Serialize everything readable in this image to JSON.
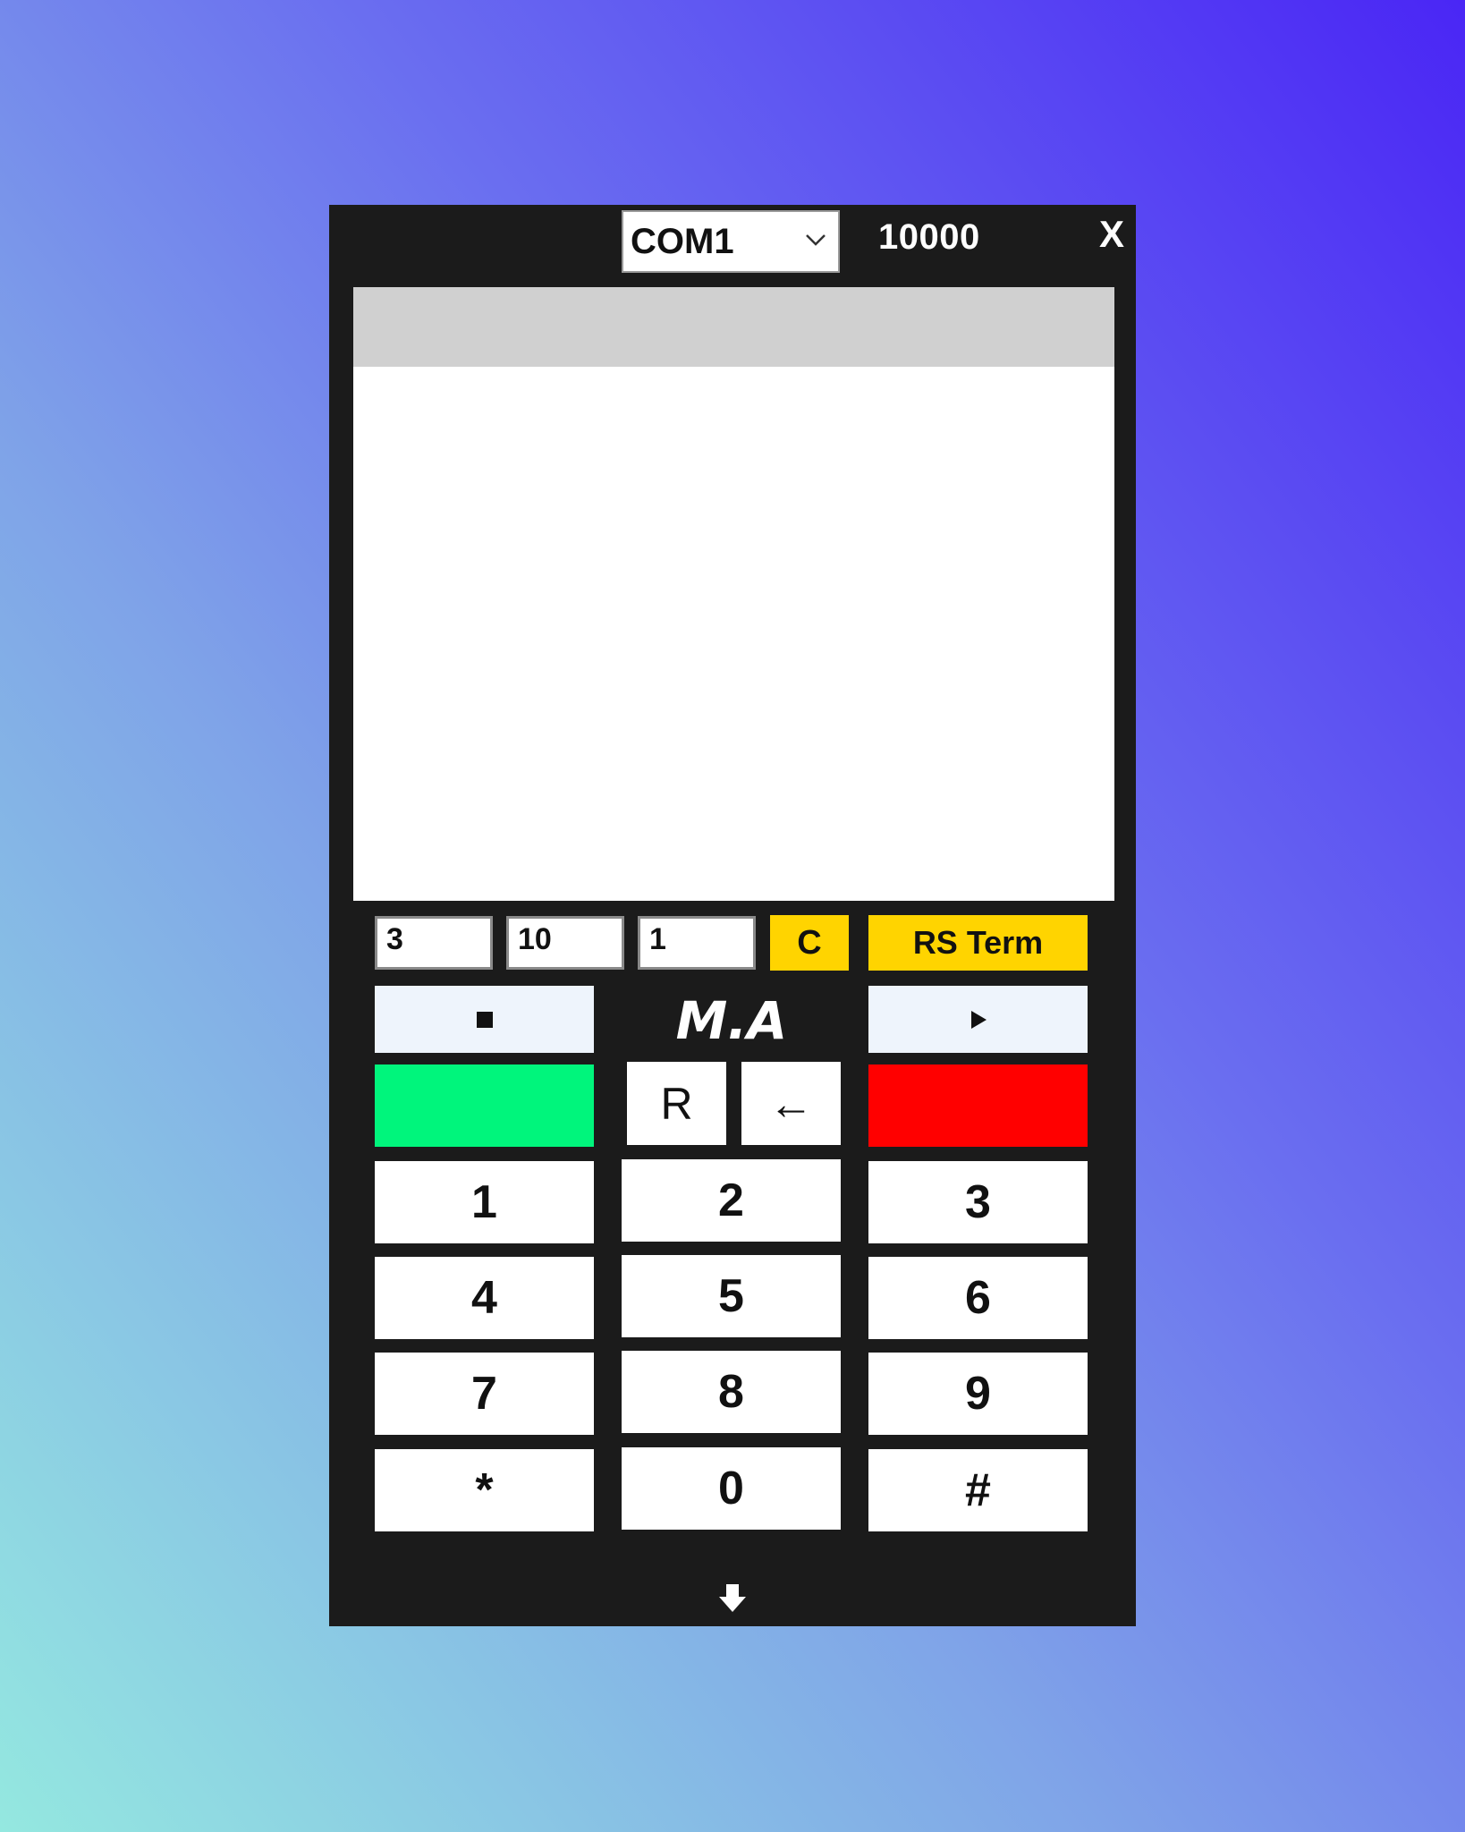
{
  "window": {
    "port": {
      "selected": "COM1",
      "icon": "chevron-down-icon"
    },
    "baud_label": "10000",
    "close_label": "X"
  },
  "controls": {
    "input_1": "3",
    "input_2": "10",
    "input_3": "1",
    "clear_label": "C",
    "rs_term_label": "RS Term",
    "stop_icon": "square-stop-icon",
    "play_icon": "play-triangle-icon",
    "logo_text": "M.A",
    "green_color": "#00f57c",
    "red_color": "#ff0000",
    "r_label": "R",
    "back_label": "←"
  },
  "keypad": {
    "k1": "1",
    "k2": "2",
    "k3": "3",
    "k4": "4",
    "k5": "5",
    "k6": "6",
    "k7": "7",
    "k8": "8",
    "k9": "9",
    "kstar": "*",
    "k0": "0",
    "khash": "#"
  },
  "footer": {
    "icon": "arrow-down-icon"
  }
}
